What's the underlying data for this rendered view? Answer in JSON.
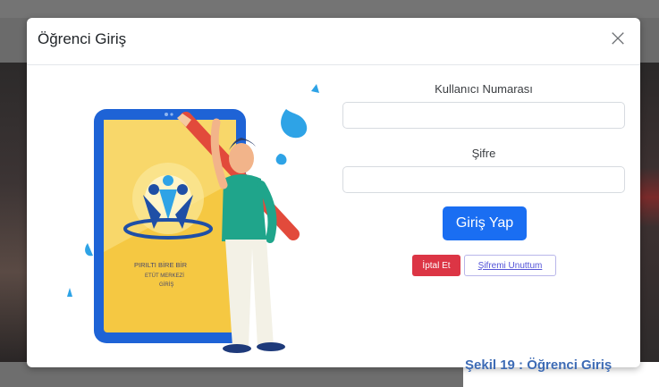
{
  "modal": {
    "title": "Öğrenci Giriş",
    "close_symbol": "×"
  },
  "illustration": {
    "logo_line1": "PIRILTI BİRE BİR",
    "logo_line2": "ETÜT MERKEZİ",
    "logo_line3": "GİRİŞ"
  },
  "form": {
    "username_label": "Kullanıcı Numarası",
    "username_value": "",
    "password_label": "Şifre",
    "password_value": "",
    "login_button": "Giriş Yap",
    "cancel_button": "İptal Et",
    "forgot_button": "Şifremi Unuttum"
  },
  "caption": "Şekil 19 : Öğrenci Giriş",
  "colors": {
    "primary": "#1a6ef2",
    "danger": "#dc3545",
    "caption": "#3d6bb5"
  }
}
